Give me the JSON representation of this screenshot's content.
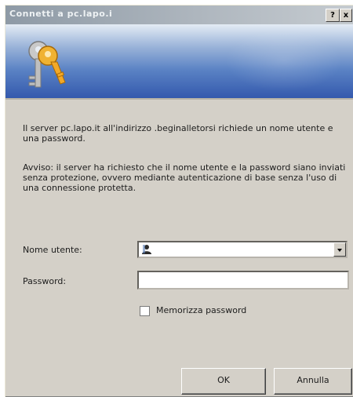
{
  "window": {
    "title": "Connetti a pc.lapo.i",
    "help_label": "?",
    "close_label": "x"
  },
  "message": {
    "line1": "Il server pc.lapo.it all'indirizzo .beginalletorsi richiede un nome utente e una password.",
    "line2": "Avviso: il server ha richiesto che il nome utente e la password siano inviati senza protezione, ovvero mediante autenticazione di base senza l'uso di una connessione protetta."
  },
  "form": {
    "username_label": "Nome utente:",
    "username_value": "",
    "password_label": "Password:",
    "password_value": "",
    "remember_label": "Memorizza password"
  },
  "buttons": {
    "ok": "OK",
    "cancel": "Annulla"
  },
  "icons": {
    "banner": "keys-icon",
    "user": "user-icon"
  }
}
